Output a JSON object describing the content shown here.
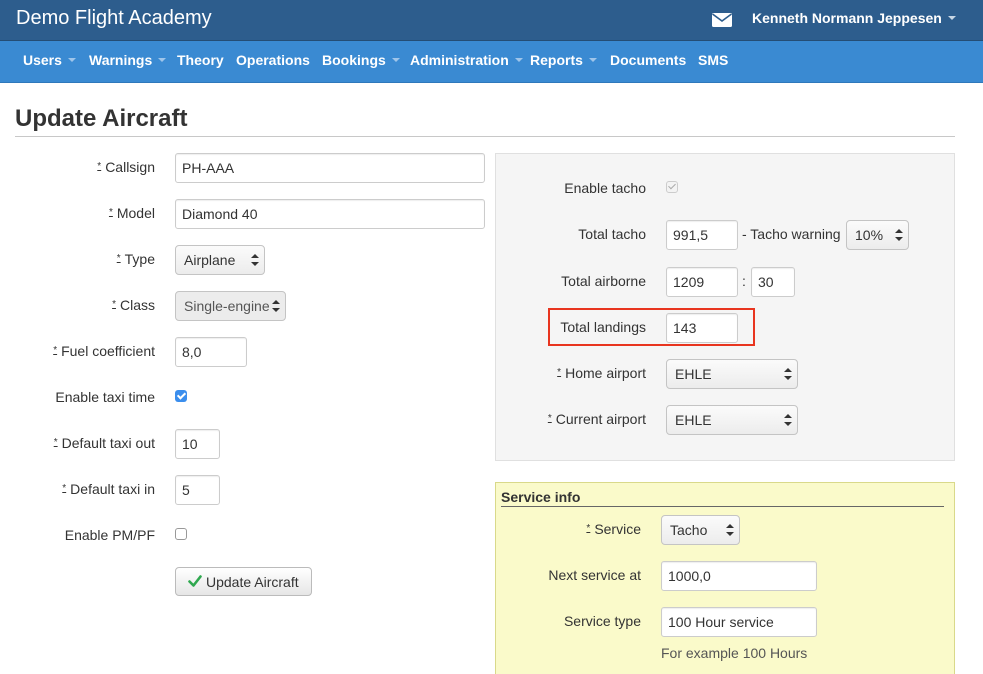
{
  "app": {
    "title": "Demo Flight Academy",
    "user": "Kenneth Normann Jeppesen"
  },
  "nav": [
    {
      "label": "Users",
      "dropdown": true
    },
    {
      "label": "Warnings",
      "dropdown": true
    },
    {
      "label": "Theory",
      "dropdown": false
    },
    {
      "label": "Operations",
      "dropdown": false
    },
    {
      "label": "Bookings",
      "dropdown": true
    },
    {
      "label": "Administration",
      "dropdown": true
    },
    {
      "label": "Reports",
      "dropdown": true
    },
    {
      "label": "Documents",
      "dropdown": false
    },
    {
      "label": "SMS",
      "dropdown": false
    }
  ],
  "page": {
    "title": "Update Aircraft"
  },
  "required_mark": "*",
  "form": {
    "callsign": {
      "label": "Callsign",
      "value": "PH-AAA"
    },
    "model": {
      "label": "Model",
      "value": "Diamond 40"
    },
    "type": {
      "label": "Type",
      "value": "Airplane"
    },
    "class": {
      "label": "Class",
      "value": "Single-engine"
    },
    "fuel_coefficient": {
      "label": "Fuel coefficient",
      "value": "8,0"
    },
    "enable_taxi_time": {
      "label": "Enable taxi time",
      "checked": true
    },
    "default_taxi_out": {
      "label": "Default taxi out",
      "value": "10"
    },
    "default_taxi_in": {
      "label": "Default taxi in",
      "value": "5"
    },
    "enable_pm_pf": {
      "label": "Enable PM/PF",
      "checked": false
    },
    "submit_label": "Update Aircraft"
  },
  "tacho": {
    "enable_tacho": {
      "label": "Enable tacho",
      "checked": true,
      "disabled": true
    },
    "total_tacho": {
      "label": "Total tacho",
      "value": "991,5"
    },
    "tacho_warning": {
      "label": "- Tacho warning",
      "value": "10%"
    },
    "total_airborne": {
      "label": "Total airborne",
      "hours": "1209",
      "separator": ":",
      "minutes": "30"
    },
    "total_landings": {
      "label": "Total landings",
      "value": "143"
    },
    "home_airport": {
      "label": "Home airport",
      "value": "EHLE"
    },
    "current_airport": {
      "label": "Current airport",
      "value": "EHLE"
    }
  },
  "service_info": {
    "title": "Service info",
    "service": {
      "label": "Service",
      "value": "Tacho"
    },
    "next_service_at": {
      "label": "Next service at",
      "value": "1000,0"
    },
    "service_type": {
      "label": "Service type",
      "value": "100 Hour service"
    },
    "help_text": "For example 100 Hours"
  },
  "colors": {
    "topbar": "#2d5d8d",
    "navbar": "#3a8ad2",
    "highlight": "#e8351f",
    "service_bg": "#fafaca"
  }
}
